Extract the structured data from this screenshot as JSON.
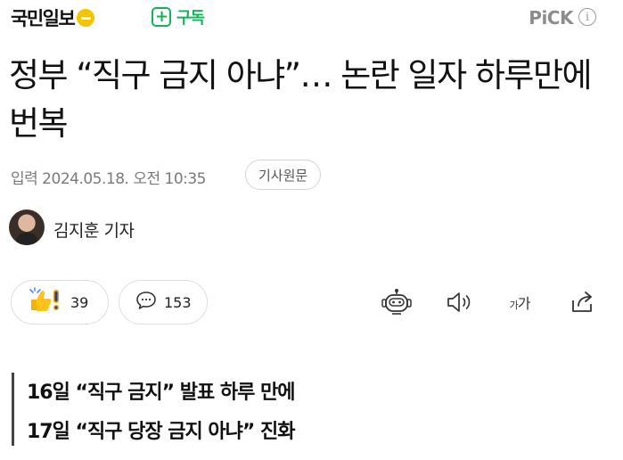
{
  "header": {
    "press_name": "국민일보",
    "subscribe_label": "구독",
    "pick_label": "PiCK",
    "info_glyph": "i"
  },
  "article": {
    "title": "정부 “직구 금지 아냐”… 논란 일자 하루만에 번복",
    "published_label": "입력 2024.05.18. 오전 10:35",
    "original_button": "기사원문",
    "author": "김지훈 기자"
  },
  "toolbar": {
    "reaction_count": "39",
    "comment_count": "153",
    "font_size_label": "가가",
    "icons": [
      "reaction-emoji-icon",
      "comment-icon",
      "bot-summary-icon",
      "speaker-icon",
      "font-size-icon",
      "share-icon"
    ]
  },
  "summary": [
    "16일 “직구 금지” 발표 하루 만에",
    "17일 “직구 당장 금지 아냐” 진화"
  ],
  "colors": {
    "subscribe_green": "#12b45a",
    "badge_yellow": "#f3c400",
    "pick_gray": "#8c8c8c"
  }
}
